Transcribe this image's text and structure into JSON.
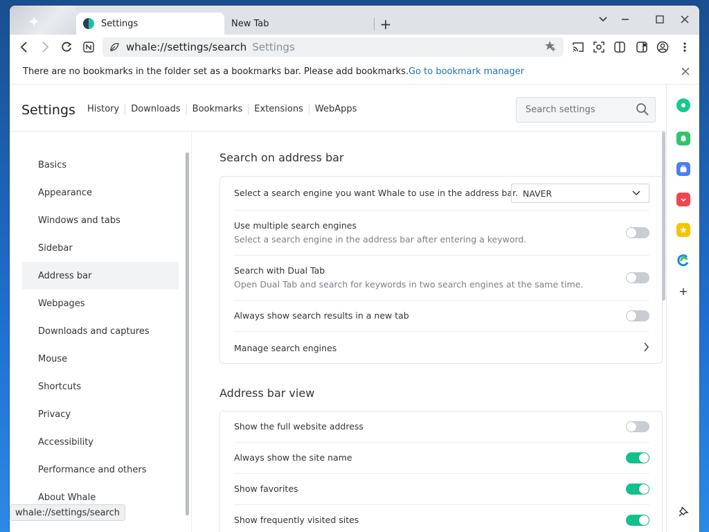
{
  "tabs": [
    {
      "label": "Settings",
      "active": true
    },
    {
      "label": "New Tab",
      "active": false
    }
  ],
  "toolbar": {
    "url": "whale://settings/search",
    "title_hint": "Settings"
  },
  "bookmark_notice": {
    "text": "There are no bookmarks in the folder set as a bookmarks bar. Please add bookmarks.",
    "link": "Go to bookmark manager"
  },
  "header": {
    "title": "Settings",
    "links": [
      "History",
      "Downloads",
      "Bookmarks",
      "Extensions",
      "WebApps"
    ],
    "search_placeholder": "Search settings"
  },
  "nav": {
    "items": [
      "Basics",
      "Appearance",
      "Windows and tabs",
      "Sidebar",
      "Address bar",
      "Webpages",
      "Downloads and captures",
      "Mouse",
      "Shortcuts",
      "Privacy",
      "Accessibility",
      "Performance and others",
      "About Whale"
    ],
    "active": "Address bar"
  },
  "sections": {
    "search": {
      "title": "Search on address bar",
      "engine_label": "Select a search engine you want Whale to use in the address bar.",
      "engine_value": "NAVER",
      "multi_label": "Use multiple search engines",
      "multi_desc": "Select a search engine in the address bar after entering a keyword.",
      "multi_on": false,
      "dual_label": "Search with Dual Tab",
      "dual_desc": "Open Dual Tab and search for keywords in two search engines at the same time.",
      "dual_on": false,
      "newtab_label": "Always show search results in a new tab",
      "newtab_on": false,
      "manage_label": "Manage search engines"
    },
    "view": {
      "title": "Address bar view",
      "full_label": "Show the full website address",
      "full_on": false,
      "sitename_label": "Always show the site name",
      "sitename_on": true,
      "favorites_label": "Show favorites",
      "favorites_on": true,
      "frequent_label": "Show frequently visited sites",
      "frequent_on": true
    }
  },
  "status_tip": "whale://settings/search",
  "colors": {
    "toggle_on": "#10c18b",
    "link": "#1a73b8"
  }
}
